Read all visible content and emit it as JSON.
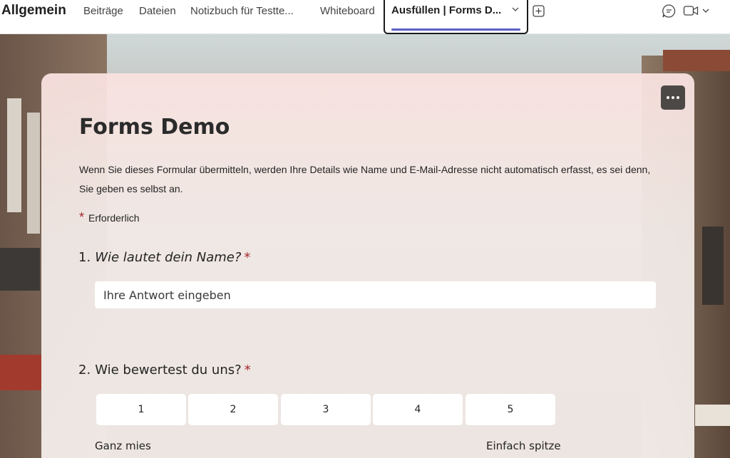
{
  "header": {
    "channel_title": "Allgemein",
    "tabs": [
      {
        "label": "Beiträge"
      },
      {
        "label": "Dateien"
      },
      {
        "label": "Notizbuch für Testte..."
      },
      {
        "label": "Whiteboard"
      }
    ],
    "active_tab": {
      "label": "Ausfüllen | Forms D..."
    },
    "icons": [
      "chevron-down-icon",
      "add-tab-icon",
      "chat-icon",
      "video-call-icon",
      "chevron-down-icon"
    ],
    "accent_color": "#5b5fc7"
  },
  "form": {
    "title": "Forms Demo",
    "description": "Wenn Sie dieses Formular übermitteln, werden Ihre Details wie Name und E-Mail-Adresse nicht automatisch erfasst, es sei denn, Sie geben es selbst an.",
    "required_star": "*",
    "required_label": "Erforderlich",
    "more_options_icon": "ellipsis-icon",
    "questions": [
      {
        "number": "1.",
        "text": "Wie lautet dein Name?",
        "required_star": "*",
        "placeholder": "Ihre Antwort eingeben"
      },
      {
        "number": "2.",
        "text": "Wie bewertest du uns?",
        "required_star": "*",
        "ratings": [
          "1",
          "2",
          "3",
          "4",
          "5"
        ],
        "min_label": "Ganz mies",
        "max_label": "Einfach spitze"
      }
    ],
    "required_color": "#a4262c"
  }
}
